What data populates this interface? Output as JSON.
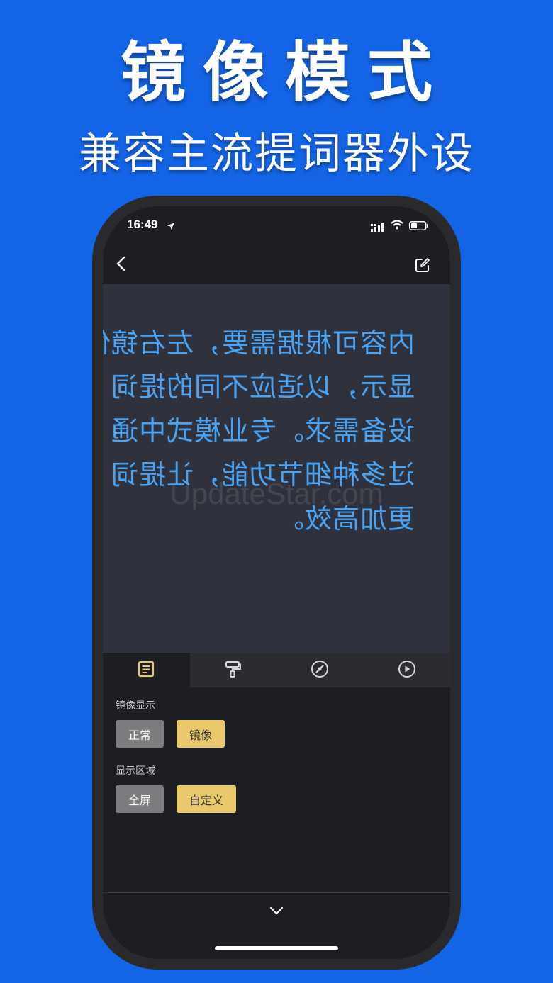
{
  "promo": {
    "title": "镜像模式",
    "subtitle": "兼容主流提词器外设"
  },
  "status_bar": {
    "time": "16:49"
  },
  "preview": {
    "lines": [
      "内容可根据需要，左右镜像",
      "显示，以适应不同的提词",
      "设备需求。专业模式中通",
      "过多种细节功能，让提词",
      "更加高效。"
    ],
    "watermark": "UpdateStar.com"
  },
  "tabs": [
    {
      "icon": "text-doc-icon",
      "active": true
    },
    {
      "icon": "paint-roller-icon",
      "active": false
    },
    {
      "icon": "speed-dial-icon",
      "active": false
    },
    {
      "icon": "play-circle-icon",
      "active": false
    }
  ],
  "settings": {
    "mirror_section": {
      "label": "镜像显示",
      "options": [
        "正常",
        "镜像"
      ],
      "selected": "镜像"
    },
    "area_section": {
      "label": "显示区域",
      "options": [
        "全屏",
        "自定义"
      ],
      "selected": "自定义"
    }
  },
  "colors": {
    "background": "#1464e6",
    "accent": "#e9c96c",
    "mirror_text": "#4aa3f2"
  }
}
